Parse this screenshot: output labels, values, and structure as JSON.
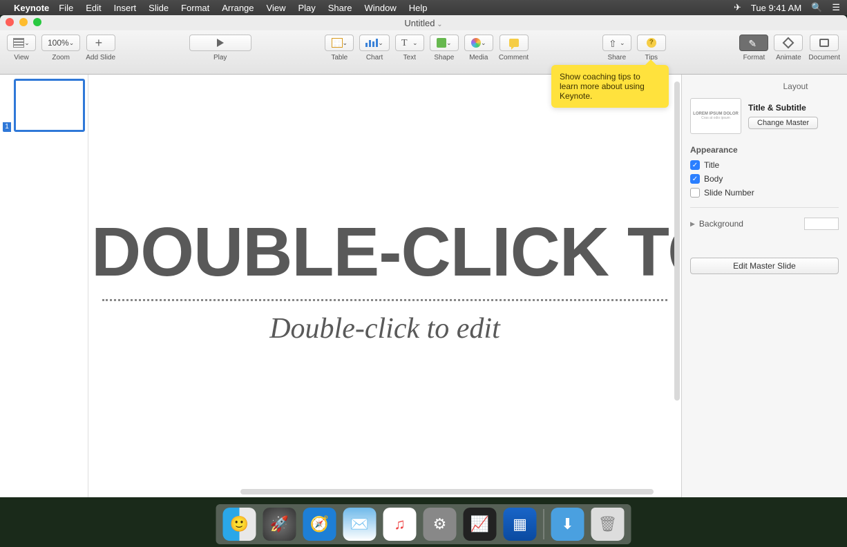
{
  "menubar": {
    "app": "Keynote",
    "items": [
      "File",
      "Edit",
      "Insert",
      "Slide",
      "Format",
      "Arrange",
      "View",
      "Play",
      "Share",
      "Window",
      "Help"
    ],
    "clock": "Tue 9:41 AM"
  },
  "window": {
    "title": "Untitled"
  },
  "toolbar": {
    "view": "View",
    "zoom_value": "100%",
    "zoom": "Zoom",
    "add_slide": "Add Slide",
    "play": "Play",
    "table": "Table",
    "chart": "Chart",
    "text": "Text",
    "shape": "Shape",
    "media": "Media",
    "comment": "Comment",
    "share": "Share",
    "tips": "Tips",
    "format": "Format",
    "animate": "Animate",
    "document": "Document"
  },
  "tooltip": {
    "text": "Show coaching tips to learn more about using Keynote."
  },
  "navigator": {
    "slides": [
      {
        "index": "1"
      }
    ]
  },
  "canvas": {
    "title_placeholder": "DOUBLE-CLICK TO EDIT",
    "subtitle_placeholder": "Double-click to edit"
  },
  "inspector": {
    "tab": "Layout",
    "master_thumb_title": "LOREM IPSUM DOLOR",
    "master_thumb_sub": "Cras at odio ipsum",
    "master_name": "Title & Subtitle",
    "change_master": "Change Master",
    "appearance": "Appearance",
    "chk_title": {
      "label": "Title",
      "checked": true
    },
    "chk_body": {
      "label": "Body",
      "checked": true
    },
    "chk_slidenum": {
      "label": "Slide Number",
      "checked": false
    },
    "background": "Background",
    "edit_master": "Edit Master Slide"
  },
  "dock": {
    "items": [
      "finder",
      "launchpad",
      "safari",
      "mail",
      "music",
      "settings",
      "activity",
      "keynote"
    ],
    "right": [
      "downloads",
      "trash"
    ]
  }
}
